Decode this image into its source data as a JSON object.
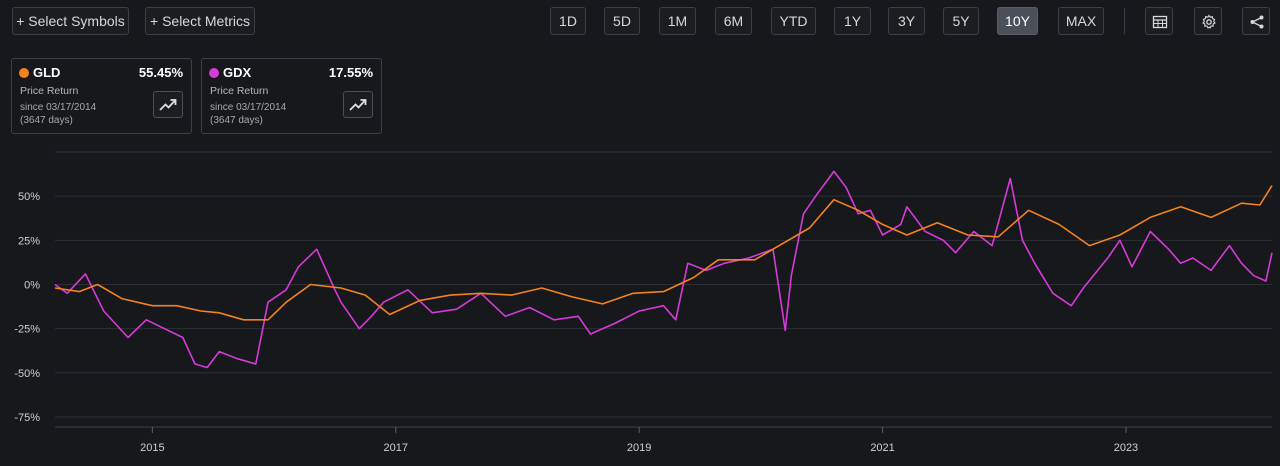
{
  "toolbar": {
    "select_symbols": "+ Select Symbols",
    "select_metrics": "+ Select Metrics",
    "ranges": [
      "1D",
      "5D",
      "1M",
      "6M",
      "YTD",
      "1Y",
      "3Y",
      "5Y",
      "10Y",
      "MAX"
    ],
    "active_range": "10Y",
    "icons": [
      "table-icon",
      "gear-icon",
      "share-icon"
    ]
  },
  "cards": [
    {
      "ticker": "GLD",
      "return": "55.45%",
      "metric": "Price Return",
      "since": "since 03/17/2014",
      "days": "(3647 days)",
      "color": "#f5821f",
      "icon": "trend-up-icon"
    },
    {
      "ticker": "GDX",
      "return": "17.55%",
      "metric": "Price Return",
      "since": "since 03/17/2014",
      "days": "(3647 days)",
      "color": "#d63ad8",
      "icon": "trend-up-icon"
    }
  ],
  "chart_data": {
    "type": "line",
    "x_ticks": [
      "2015",
      "2017",
      "2019",
      "2021",
      "2023"
    ],
    "y_ticks": [
      "50%",
      "25%",
      "0%",
      "-25%",
      "-50%",
      "-75%"
    ],
    "ylim": [
      -75,
      75
    ],
    "xlim": [
      2014.2,
      2024.2
    ],
    "grid": true,
    "series": [
      {
        "name": "GLD",
        "color": "#f5821f",
        "x": [
          2014.2,
          2014.4,
          2014.55,
          2014.75,
          2015.0,
          2015.2,
          2015.4,
          2015.55,
          2015.75,
          2015.95,
          2016.1,
          2016.3,
          2016.55,
          2016.75,
          2016.95,
          2017.2,
          2017.45,
          2017.7,
          2017.95,
          2018.2,
          2018.45,
          2018.7,
          2018.95,
          2019.2,
          2019.45,
          2019.65,
          2019.95,
          2020.2,
          2020.4,
          2020.6,
          2020.8,
          2021.0,
          2021.2,
          2021.45,
          2021.7,
          2021.95,
          2022.2,
          2022.45,
          2022.7,
          2022.95,
          2023.2,
          2023.45,
          2023.7,
          2023.95,
          2024.1,
          2024.2
        ],
        "y": [
          -2,
          -4,
          0,
          -8,
          -12,
          -12,
          -15,
          -16,
          -20,
          -20,
          -10,
          0,
          -2,
          -6,
          -17,
          -9,
          -6,
          -5,
          -6,
          -2,
          -7,
          -11,
          -5,
          -4,
          4,
          14,
          14,
          24,
          32,
          48,
          42,
          34,
          28,
          35,
          28,
          27,
          42,
          34,
          22,
          28,
          38,
          44,
          38,
          46,
          45,
          56
        ]
      },
      {
        "name": "GDX",
        "color": "#d63ad8",
        "x": [
          2014.2,
          2014.3,
          2014.45,
          2014.6,
          2014.8,
          2014.95,
          2015.1,
          2015.25,
          2015.35,
          2015.45,
          2015.55,
          2015.7,
          2015.85,
          2015.95,
          2016.1,
          2016.2,
          2016.35,
          2016.5,
          2016.55,
          2016.7,
          2016.8,
          2016.9,
          2017.1,
          2017.3,
          2017.5,
          2017.7,
          2017.9,
          2018.1,
          2018.3,
          2018.5,
          2018.6,
          2018.8,
          2019.0,
          2019.2,
          2019.3,
          2019.4,
          2019.55,
          2019.7,
          2019.9,
          2020.1,
          2020.2,
          2020.25,
          2020.35,
          2020.45,
          2020.6,
          2020.7,
          2020.8,
          2020.9,
          2021.0,
          2021.15,
          2021.2,
          2021.35,
          2021.5,
          2021.6,
          2021.75,
          2021.9,
          2022.05,
          2022.15,
          2022.25,
          2022.4,
          2022.55,
          2022.65,
          2022.85,
          2022.95,
          2023.05,
          2023.2,
          2023.35,
          2023.45,
          2023.55,
          2023.7,
          2023.85,
          2023.95,
          2024.05,
          2024.15,
          2024.2
        ],
        "y": [
          0,
          -5,
          6,
          -15,
          -30,
          -20,
          -25,
          -30,
          -45,
          -47,
          -38,
          -42,
          -45,
          -10,
          -3,
          10,
          20,
          -3,
          -10,
          -25,
          -18,
          -10,
          -3,
          -16,
          -14,
          -5,
          -18,
          -13,
          -20,
          -18,
          -28,
          -22,
          -15,
          -12,
          -20,
          12,
          8,
          12,
          15,
          20,
          -26,
          5,
          40,
          50,
          64,
          55,
          40,
          42,
          28,
          34,
          44,
          30,
          25,
          18,
          30,
          22,
          60,
          25,
          12,
          -5,
          -12,
          -2,
          15,
          25,
          10,
          30,
          20,
          12,
          15,
          8,
          22,
          12,
          5,
          2,
          18
        ]
      }
    ]
  }
}
